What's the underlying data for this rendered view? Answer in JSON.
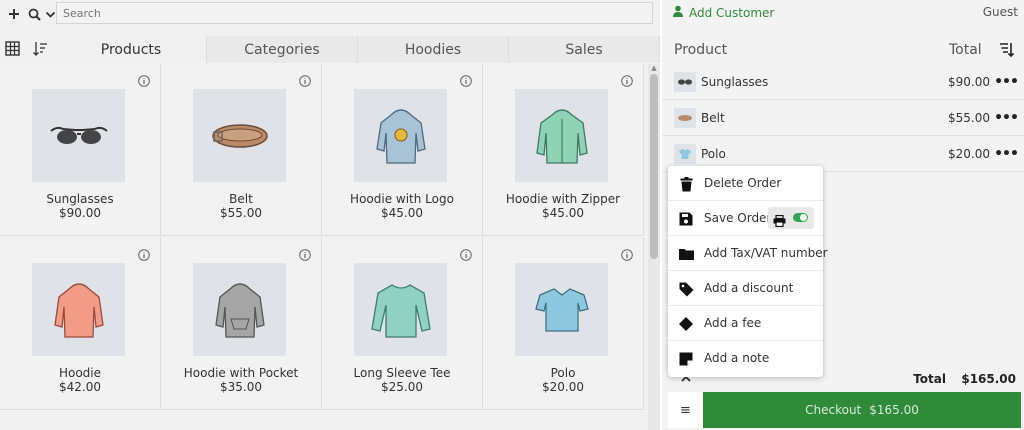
{
  "search": {
    "placeholder": "Search"
  },
  "tabs": [
    {
      "label": "Products",
      "active": true
    },
    {
      "label": "Categories",
      "active": false
    },
    {
      "label": "Hoodies",
      "active": false
    },
    {
      "label": "Sales",
      "active": false
    }
  ],
  "products": [
    {
      "name": "Sunglasses",
      "price": "$90.00",
      "icon": "sunglasses-image"
    },
    {
      "name": "Belt",
      "price": "$55.00",
      "icon": "belt-image"
    },
    {
      "name": "Hoodie with Logo",
      "price": "$45.00",
      "icon": "hoodie-logo-image"
    },
    {
      "name": "Hoodie with Zipper",
      "price": "$45.00",
      "icon": "hoodie-zipper-image"
    },
    {
      "name": "Hoodie",
      "price": "$42.00",
      "icon": "hoodie-image"
    },
    {
      "name": "Hoodie with Pocket",
      "price": "$35.00",
      "icon": "hoodie-pocket-image"
    },
    {
      "name": "Long Sleeve Tee",
      "price": "$25.00",
      "icon": "long-sleeve-tee-image"
    },
    {
      "name": "Polo",
      "price": "$20.00",
      "icon": "polo-image"
    }
  ],
  "customer": {
    "add_label": "Add Customer",
    "current": "Guest"
  },
  "cart": {
    "header_product": "Product",
    "header_total": "Total",
    "items": [
      {
        "name": "Sunglasses",
        "price": "$90.00"
      },
      {
        "name": "Belt",
        "price": "$55.00"
      },
      {
        "name": "Polo",
        "price": "$20.00"
      }
    ],
    "total_label": "Total",
    "total_value": "$165.00"
  },
  "checkout": {
    "label": "Checkout",
    "amount": "$165.00",
    "color": "#2f8a3a"
  },
  "menu": {
    "items": [
      {
        "label": "Delete Order",
        "icon": "trash-icon"
      },
      {
        "label": "Save Order",
        "icon": "save-icon"
      },
      {
        "label": "Add Tax/VAT number",
        "icon": "folder-icon"
      },
      {
        "label": "Add a discount",
        "icon": "tag-icon"
      },
      {
        "label": "Add a fee",
        "icon": "diamond-icon"
      },
      {
        "label": "Add a note",
        "icon": "note-icon"
      }
    ]
  },
  "colors": {
    "accent_green": "#2e8b3a",
    "toggle_on": "#33a852"
  }
}
